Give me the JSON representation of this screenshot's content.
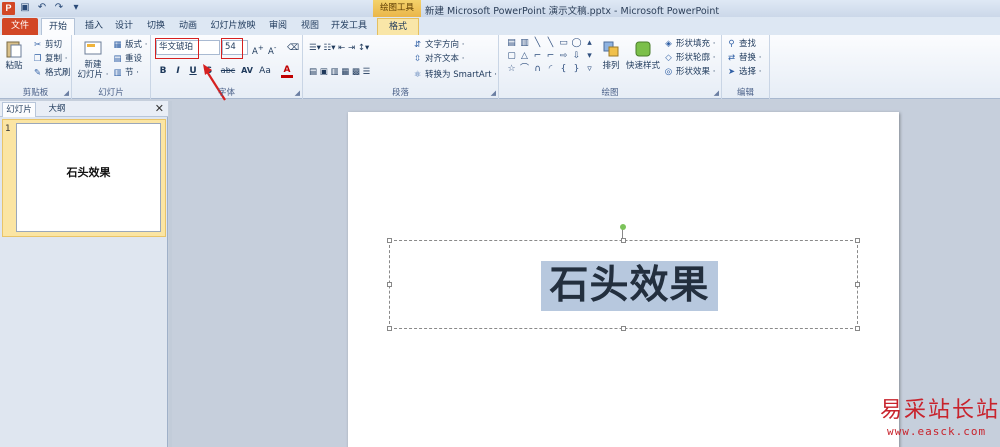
{
  "app": {
    "icon_letter": "P",
    "context_tab_title": "绘图工具",
    "window_title": "新建 Microsoft PowerPoint 演示文稿.pptx - Microsoft PowerPoint"
  },
  "qat": [
    "save-icon",
    "undo-icon",
    "redo-icon",
    "customize-icon"
  ],
  "tabs": {
    "file": "文件",
    "home": "开始",
    "insert": "插入",
    "design": "设计",
    "transitions": "切换",
    "animations": "动画",
    "slideshow": "幻灯片放映",
    "review": "审阅",
    "view": "视图",
    "developer": "开发工具",
    "format": "格式"
  },
  "ribbon": {
    "clipboard": {
      "label": "剪贴板",
      "paste": "粘贴",
      "cut": "剪切",
      "copy": "复制 ·",
      "format_painter": "格式刷"
    },
    "slides": {
      "label": "幻灯片",
      "new_slide": "新建",
      "new_slide2": "幻灯片 ·",
      "layout": "版式 ·",
      "reset": "重设",
      "section": "节 ·"
    },
    "font": {
      "label": "字体",
      "font_name": "华文琥珀",
      "font_size": "54",
      "bold": "B",
      "italic": "I",
      "underline": "U",
      "strike": "S",
      "abc": "abc",
      "spacing": "AV",
      "case": "Aa",
      "color": "A"
    },
    "paragraph": {
      "label": "段落",
      "text_direction": "文字方向 ·",
      "align_text": "对齐文本 ·",
      "convert_smartart": "转换为 SmartArt ·"
    },
    "drawing": {
      "label": "绘图",
      "arrange": "排列",
      "quick_styles": "快速样式",
      "shape_fill": "形状填充 ·",
      "shape_outline": "形状轮廓 ·",
      "shape_effects": "形状效果 ·"
    },
    "editing": {
      "label": "编辑",
      "find": "查找",
      "replace": "替换 ·",
      "select": "选择 ·"
    }
  },
  "panel": {
    "tab_slides": "幻灯片",
    "tab_outline": "大纲",
    "close": "✕",
    "slide_number": "1",
    "thumb_text": "石头效果"
  },
  "slide": {
    "text": "石头效果",
    "highlight_color": "#b7c8de"
  },
  "watermark": {
    "text": "易采站长站",
    "url": "www.easck.com"
  },
  "colors": {
    "file_tab": "#d24726",
    "annotation_red": "#d62020",
    "rotation_handle": "#7bc35a"
  }
}
